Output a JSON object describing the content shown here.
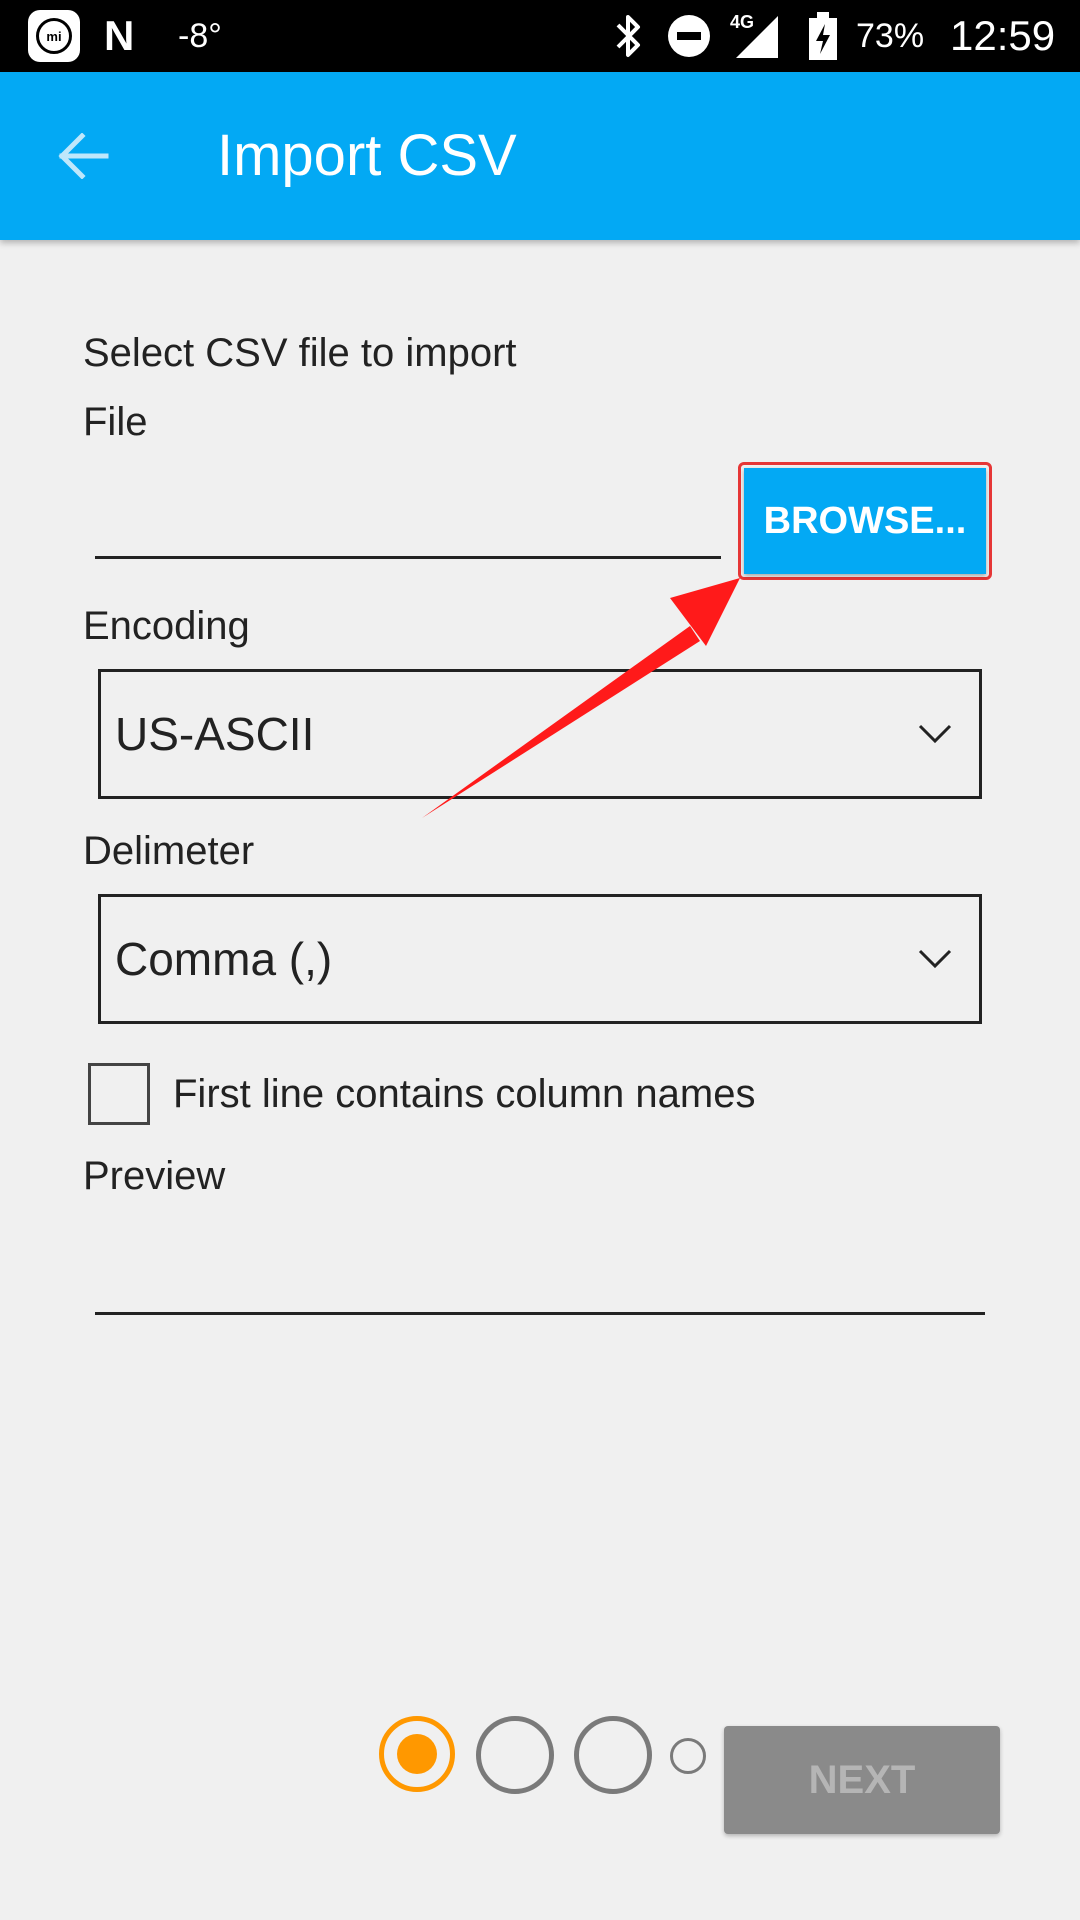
{
  "status_bar": {
    "mi_label": "mi",
    "n_label": "N",
    "temperature": "-8°",
    "network": "4G",
    "battery_percent": "73%",
    "time": "12:59",
    "icons": [
      "mi-app-icon",
      "n-app-icon",
      "bluetooth-icon",
      "do-not-disturb-icon",
      "signal-icon",
      "battery-charging-icon"
    ]
  },
  "app_bar": {
    "back_icon": "arrow-back-icon",
    "title": "Import CSV",
    "color": "#03a9f4"
  },
  "form": {
    "section_title": "Select CSV file to import",
    "file_label": "File",
    "file_value": "",
    "browse_label": "BROWSE...",
    "encoding_label": "Encoding",
    "encoding_value": "US-ASCII",
    "delimiter_label": "Delimeter",
    "delimiter_value": "Comma (,)",
    "first_line_checkbox_label": "First line contains column names",
    "first_line_checked": false,
    "preview_label": "Preview",
    "preview_value": ""
  },
  "footer": {
    "steps_total": 4,
    "current_step": 1,
    "next_label": "NEXT",
    "next_enabled": false,
    "accent_color": "#ff9800"
  },
  "annotation": {
    "type": "red-arrow",
    "target": "browse-button",
    "color": "#ff1a1a"
  }
}
